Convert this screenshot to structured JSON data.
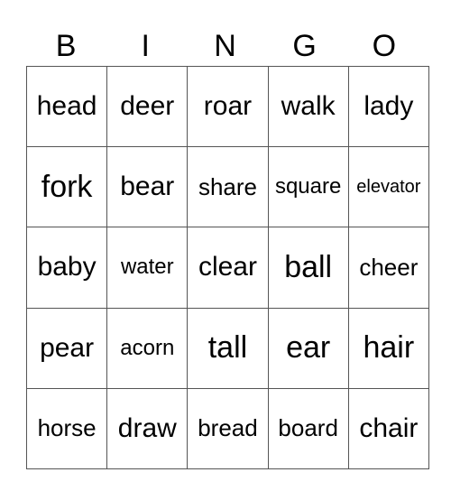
{
  "header": [
    "B",
    "I",
    "N",
    "G",
    "O"
  ],
  "rows": [
    [
      "head",
      "deer",
      "roar",
      "walk",
      "lady"
    ],
    [
      "fork",
      "bear",
      "share",
      "square",
      "elevator"
    ],
    [
      "baby",
      "water",
      "clear",
      "ball",
      "cheer"
    ],
    [
      "pear",
      "acorn",
      "tall",
      "ear",
      "hair"
    ],
    [
      "horse",
      "draw",
      "bread",
      "board",
      "chair"
    ]
  ]
}
